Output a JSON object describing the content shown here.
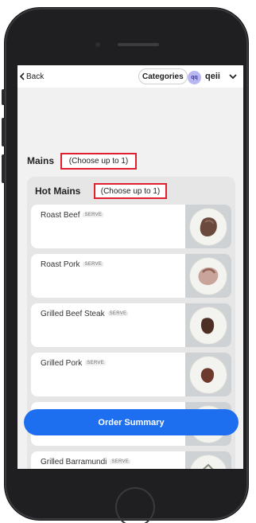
{
  "topbar": {
    "back_label": "Back",
    "categories_label": "Categories",
    "avatar_initials": "qq",
    "user_name": "qeii"
  },
  "section": {
    "title": "Mains",
    "choose_label": "(Choose up to 1)"
  },
  "group": {
    "title": "Hot Mains",
    "choose_label": "(Choose up to 1)"
  },
  "items": [
    {
      "name": "Roast Beef",
      "badge": "SERVE",
      "image": "roast-beef-plate"
    },
    {
      "name": "Roast Pork",
      "badge": "SERVE",
      "image": "roast-pork-plate"
    },
    {
      "name": "Grilled Beef Steak",
      "badge": "SERVE",
      "image": "grilled-beef-steak-plate"
    },
    {
      "name": "Grilled Pork",
      "badge": "SERVE",
      "image": "grilled-pork-plate"
    },
    {
      "name": "",
      "badge": "",
      "image": "hidden-item-plate"
    },
    {
      "name": "Grilled Barramundi",
      "badge": "SERVE",
      "image": "grilled-barramundi-plate"
    }
  ],
  "order_button_label": "Order Summary",
  "colors": {
    "accent": "#1e6ff0",
    "highlight_box": "#e0202f",
    "avatar_bg": "#b9b7f2",
    "screen_bg": "#f1f1f1",
    "group_bg": "#e6e6e6"
  }
}
